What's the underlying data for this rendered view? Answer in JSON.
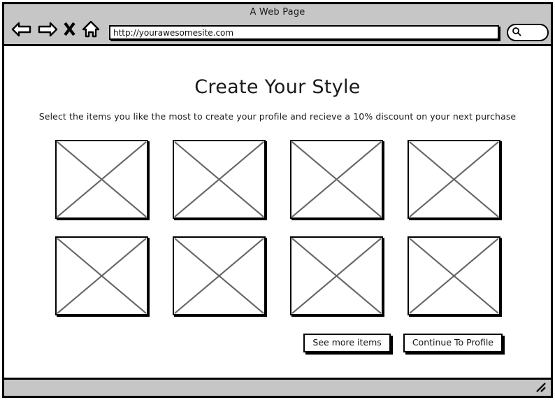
{
  "browser": {
    "window_title": "A Web Page",
    "nav": {
      "back_icon": "back-arrow-icon",
      "forward_icon": "forward-arrow-icon",
      "stop_icon": "stop-x-icon",
      "home_icon": "home-house-icon"
    },
    "url_bar": {
      "value": "http://yourawesomesite.com",
      "placeholder": "http://"
    },
    "search_box": {
      "value": "",
      "placeholder": "",
      "icon": "search-magnifier-icon"
    },
    "status_bar": {
      "resize_grip_icon": "resize-grip-icon"
    }
  },
  "page": {
    "title": "Create Your Style",
    "subtitle": "Select the items you like the most to create your profile and recieve a 10% discount on your next purchase",
    "grid": {
      "columns": 4,
      "rows": 2,
      "items": [
        {
          "alt": "image-placeholder-1"
        },
        {
          "alt": "image-placeholder-2"
        },
        {
          "alt": "image-placeholder-3"
        },
        {
          "alt": "image-placeholder-4"
        },
        {
          "alt": "image-placeholder-5"
        },
        {
          "alt": "image-placeholder-6"
        },
        {
          "alt": "image-placeholder-7"
        },
        {
          "alt": "image-placeholder-8"
        }
      ]
    },
    "buttons": {
      "see_more": "See more items",
      "continue": "Continue To Profile"
    }
  },
  "colors": {
    "chrome_gray": "#c6c6c6",
    "line_black": "#000000",
    "placeholder_x_gray": "#666666",
    "page_white": "#ffffff"
  }
}
